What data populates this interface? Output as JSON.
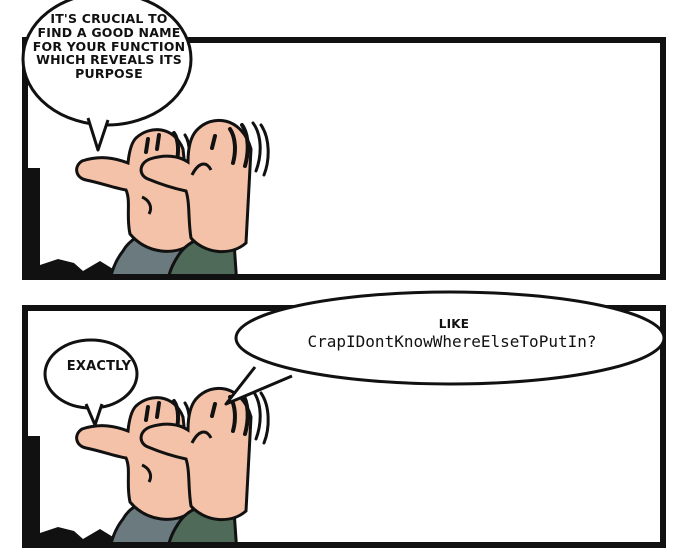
{
  "comic": {
    "panel1": {
      "speech": [
        "IT'S CRUCIAL TO",
        "FIND A GOOD NAME",
        "FOR YOUR FUNCTION",
        "WHICH REVEALS ITS",
        "PURPOSE"
      ]
    },
    "panel2": {
      "left_speech": "EXACTLY",
      "right_speech_label": "LIKE",
      "right_speech_code": "CrapIDontKnowWhereElseToPutIn?"
    }
  },
  "colors": {
    "ink": "#111111",
    "skin": "#f4c2a8",
    "shirt_left": "#6b7a7f",
    "shirt_right": "#4f6a58",
    "panel_bg": "#ffffff"
  },
  "icons": {
    "speech_bubble": "speech-bubble-icon",
    "character": "cartoon-character-icon"
  }
}
